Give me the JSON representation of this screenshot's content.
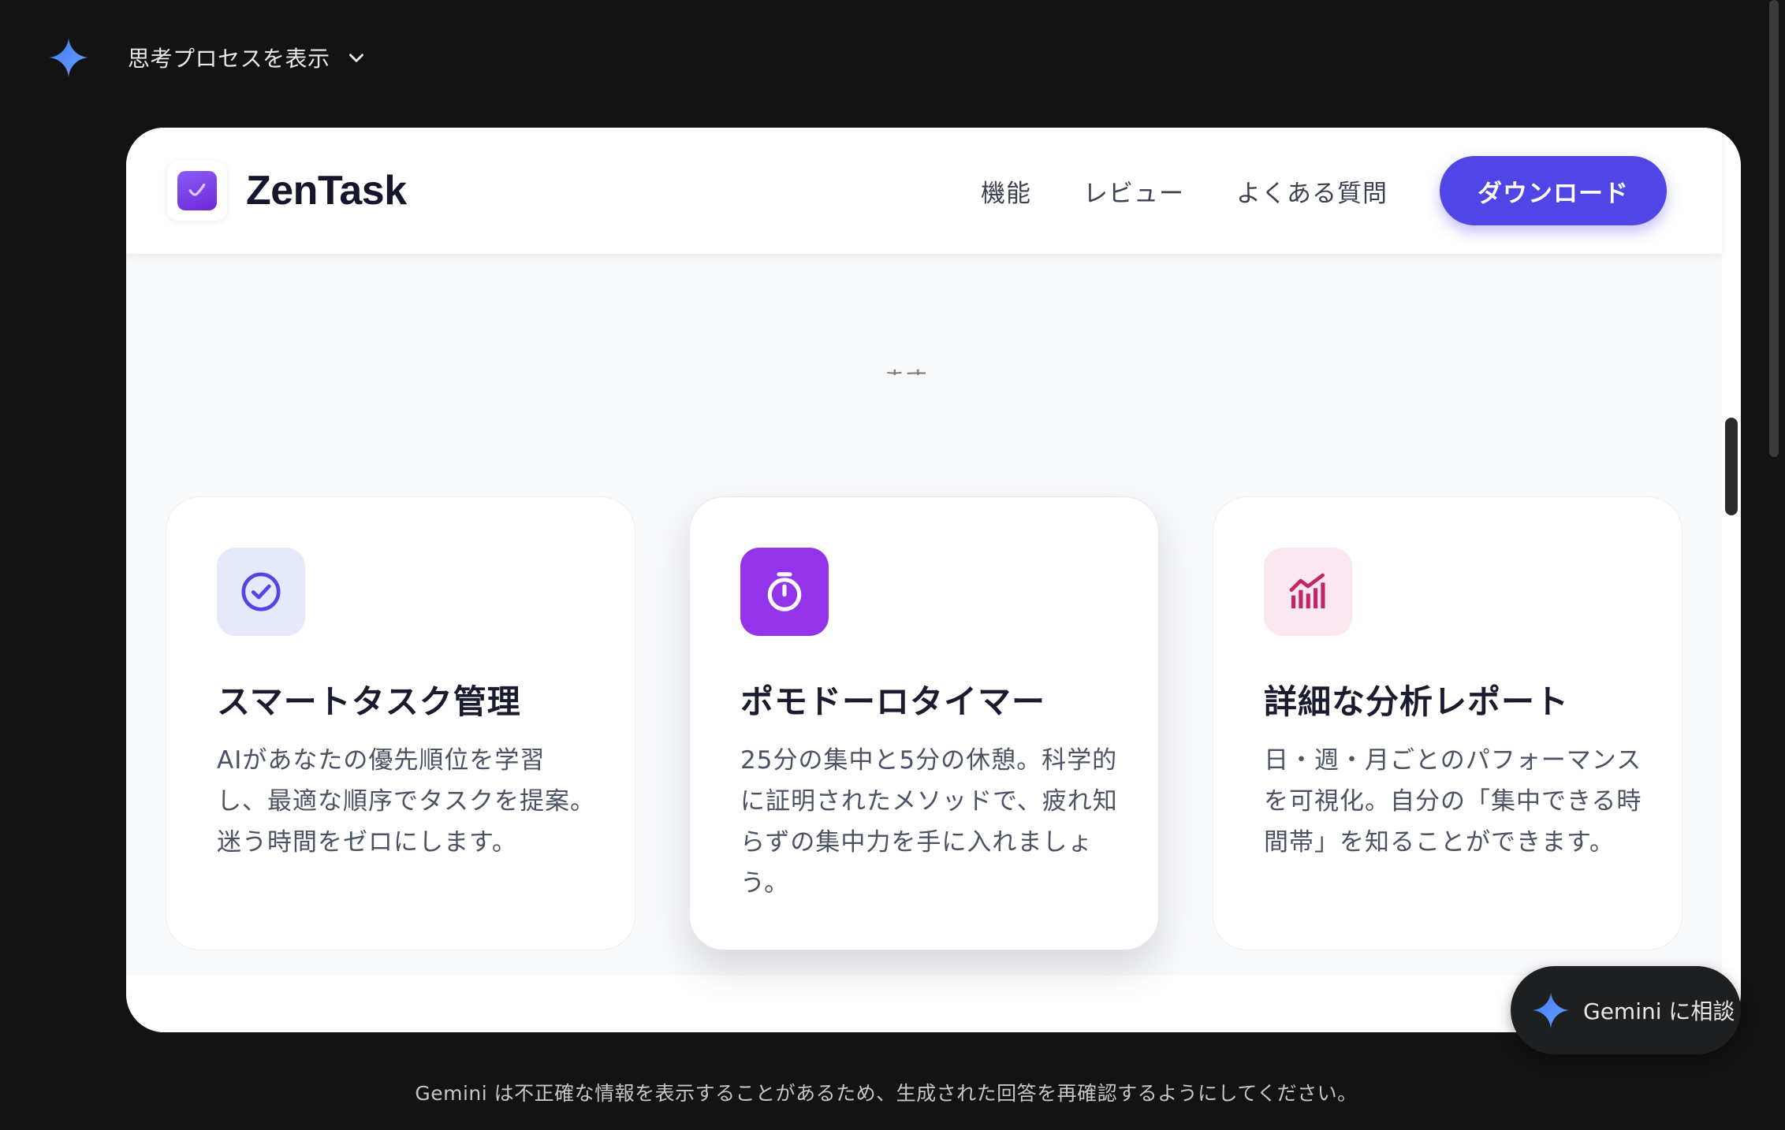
{
  "thinking": {
    "label": "思考プロセスを表示"
  },
  "site": {
    "brand": "ZenTask",
    "nav": [
      "機能",
      "レビュー",
      "よくある質問"
    ],
    "cta": "ダウンロード",
    "peek_text": "ます。"
  },
  "features": [
    {
      "title": "スマートタスク管理",
      "desc": "AIがあなたの優先順位を学習し、最適な順序でタスクを提案。迷う時間をゼロにします。",
      "icon": "check-circle-icon",
      "icon_bg": "#e6e8fb",
      "icon_color": "#4f46e5"
    },
    {
      "title": "ポモドーロタイマー",
      "desc": "25分の集中と5分の休憩。科学的に証明されたメソッドで、疲れ知らずの集中力を手に入れましょう。",
      "icon": "stopwatch-icon",
      "icon_bg": "#9333ea",
      "icon_color": "#ffffff"
    },
    {
      "title": "詳細な分析レポート",
      "desc": "日・週・月ごとのパフォーマンスを可視化。自分の「集中できる時間帯」を知ることができます。",
      "icon": "analytics-chart-icon",
      "icon_bg": "#fbe7f0",
      "icon_color": "#c02668"
    }
  ],
  "ask": {
    "label": "Gemini に相談"
  },
  "disclaimer": "Gemini は不正確な情報を表示することがあるため、生成された回答を再確認するようにしてください。",
  "colors": {
    "accent": "#4f46e5",
    "gemini_blue": "#4c7ef3"
  }
}
